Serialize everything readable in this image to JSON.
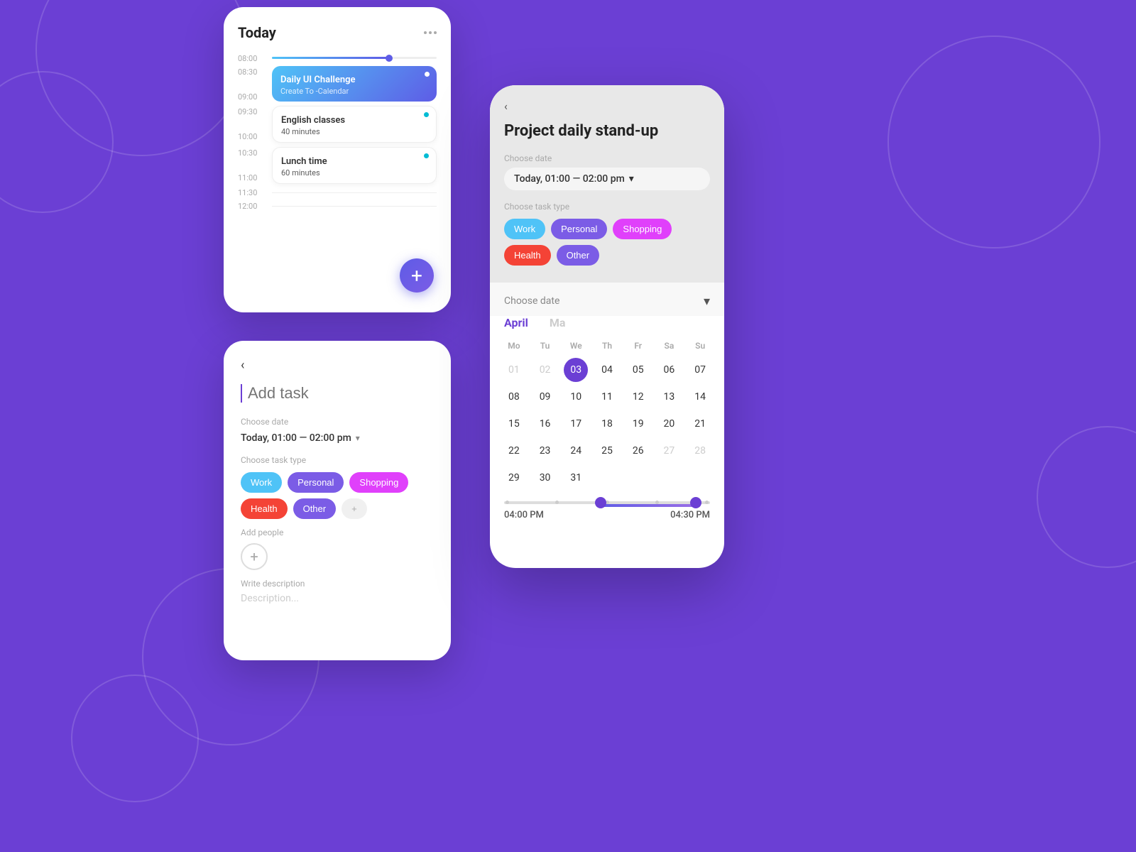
{
  "background": {
    "color": "#6B3FD4"
  },
  "card_today": {
    "title": "Today",
    "time_slots": [
      {
        "time": "08:00"
      },
      {
        "time": "08:30"
      },
      {
        "time": "09:00"
      },
      {
        "time": "09:30"
      },
      {
        "time": "10:00"
      },
      {
        "time": "10:30"
      },
      {
        "time": "11:00"
      },
      {
        "time": "11:30"
      },
      {
        "time": "12:00"
      }
    ],
    "events": [
      {
        "title": "Daily UI Challenge",
        "subtitle": "Create To -Calendar",
        "type": "blue"
      },
      {
        "title": "English classes",
        "subtitle": "40 minutes",
        "type": "white"
      },
      {
        "title": "Lunch time",
        "subtitle": "60 minutes",
        "type": "white"
      }
    ],
    "fab_label": "+"
  },
  "card_add_task": {
    "back_label": "‹",
    "input_placeholder": "Add task",
    "choose_date_label": "Choose date",
    "date_value": "Today, 01:00 — 02:00 pm",
    "task_type_label": "Choose task type",
    "tags": [
      "Work",
      "Personal",
      "Shopping",
      "Health",
      "Other",
      "+"
    ],
    "add_people_label": "Add people",
    "add_people_icon": "+",
    "write_description_label": "Write description",
    "description_placeholder": "Description..."
  },
  "card_standup": {
    "back_label": "‹",
    "title": "Project daily stand-up",
    "choose_date_label": "Choose date",
    "date_value": "Today, 01:00 — 02:00 pm",
    "task_type_label": "Choose task type",
    "tags": [
      "Work",
      "Personal",
      "Shopping",
      "Health",
      "Other"
    ]
  },
  "card_calendar": {
    "choose_date_label": "Choose date",
    "months": [
      {
        "name": "April",
        "active": true
      },
      {
        "name": "Ma",
        "active": false
      }
    ],
    "day_headers": [
      "Mo",
      "Tu",
      "We",
      "Th",
      "Fr",
      "Sa",
      "Su"
    ],
    "weeks": [
      [
        "01",
        "02",
        "03",
        "04",
        "05",
        "06",
        "07"
      ],
      [
        "08",
        "09",
        "10",
        "11",
        "12",
        "13",
        "14"
      ],
      [
        "15",
        "16",
        "17",
        "18",
        "19",
        "20",
        "21"
      ],
      [
        "22",
        "23",
        "24",
        "25",
        "26",
        "27",
        "28"
      ],
      [
        "29",
        "30",
        "31",
        "",
        "",
        "",
        ""
      ]
    ],
    "selected_day": "03",
    "muted_days": [
      "01",
      "02",
      "27",
      "28"
    ],
    "time_start": "04:00 PM",
    "time_end": "04:30 PM"
  }
}
